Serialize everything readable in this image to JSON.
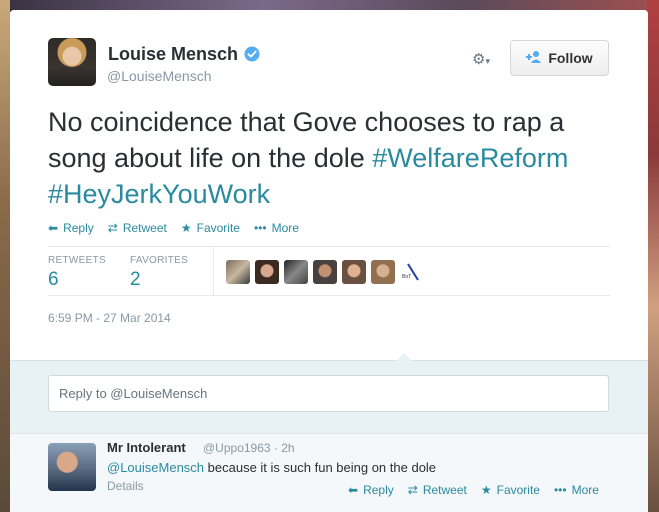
{
  "author": {
    "name": "Louise Mensch",
    "handle": "@LouiseMensch"
  },
  "follow_label": "Follow",
  "tweet": {
    "text_plain": "No coincidence that Gove chooses to rap a song about life on the dole",
    "hashtag1": "#WelfareReform",
    "hashtag2": "#HeyJerkYouWork"
  },
  "actions": {
    "reply": "Reply",
    "retweet": "Retweet",
    "favorite": "Favorite",
    "more": "More"
  },
  "stats": {
    "retweets_label": "RETWEETS",
    "retweets_value": "6",
    "favorites_label": "FAVORITES",
    "favorites_value": "2"
  },
  "timestamp": "6:59 PM - 27 Mar 2014",
  "reply_box": {
    "placeholder": "Reply to @LouiseMensch"
  },
  "reply": {
    "name": "Mr Intolerant",
    "handle": "@Uppo1963 · 2h",
    "mention": "@LouiseMensch",
    "text": "because it is such fun being on the dole",
    "details": "Details",
    "reply": "Reply",
    "retweet": "Retweet",
    "favorite": "Favorite",
    "more": "More"
  },
  "colors": {
    "link": "#2a8aa0",
    "verified": "#55acee",
    "muted": "#8899a6"
  },
  "icons": [
    "verified-badge-icon",
    "gear-icon",
    "add-user-icon",
    "reply-icon",
    "retweet-icon",
    "star-icon",
    "more-icon"
  ]
}
